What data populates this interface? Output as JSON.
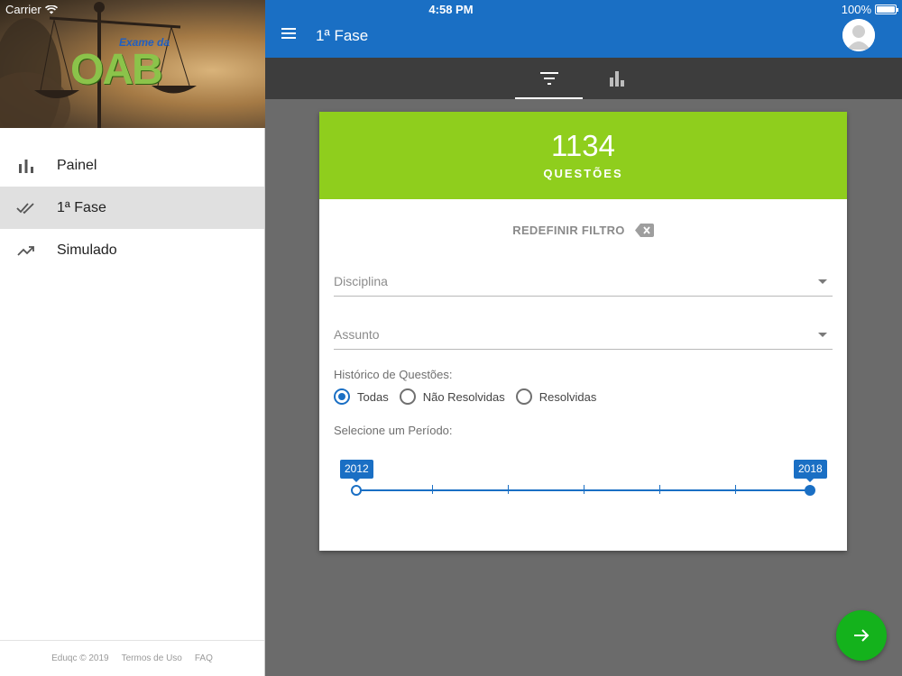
{
  "status": {
    "carrier": "Carrier",
    "time": "4:58 PM",
    "battery": "100%"
  },
  "sidebar": {
    "logo": {
      "small": "Exame da",
      "big": "OAB"
    },
    "items": [
      {
        "label": "Painel",
        "icon": "bar-chart-icon"
      },
      {
        "label": "1ª Fase",
        "icon": "double-check-icon",
        "active": true
      },
      {
        "label": "Simulado",
        "icon": "trending-up-icon"
      }
    ],
    "footer": {
      "copyright": "Eduqc © 2019",
      "terms": "Termos de Uso",
      "faq": "FAQ"
    }
  },
  "appbar": {
    "title": "1ª Fase"
  },
  "tabs": [
    {
      "icon": "filter-icon",
      "active": true
    },
    {
      "icon": "bar-chart-icon"
    }
  ],
  "card": {
    "count": "1134",
    "count_label": "QUESTÕES",
    "reset_label": "REDEFINIR FILTRO",
    "discipline": {
      "placeholder": "Disciplina"
    },
    "subject": {
      "placeholder": "Assunto"
    },
    "history_label": "Histórico de Questões:",
    "history_options": [
      {
        "label": "Todas",
        "checked": true
      },
      {
        "label": "Não Resolvidas",
        "checked": false
      },
      {
        "label": "Resolvidas",
        "checked": false
      }
    ],
    "period_label": "Selecione um Período:",
    "period": {
      "start": "2012",
      "end": "2018"
    }
  },
  "colors": {
    "primary": "#1a6fc4",
    "success": "#8fce1d",
    "fab": "#14b21c"
  }
}
